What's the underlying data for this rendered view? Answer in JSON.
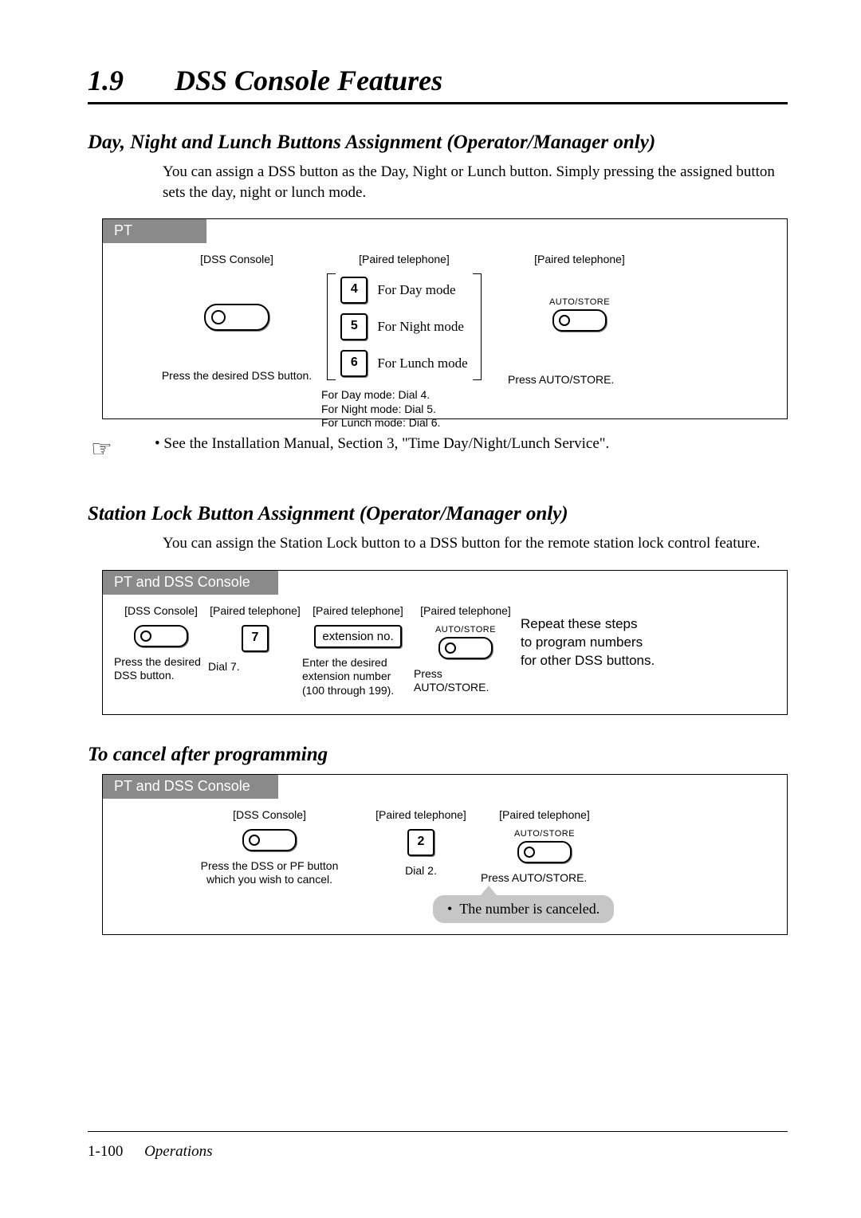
{
  "header": {
    "number": "1.9",
    "title": "DSS Console Features"
  },
  "sec1": {
    "heading": "Day, Night and Lunch Buttons Assignment (Operator/Manager only)",
    "intro": "You can assign a DSS button as the Day, Night or Lunch button. Simply pressing the assigned button sets the day, night or lunch mode.",
    "tab": "PT",
    "col1": {
      "label": "[DSS Console]",
      "caption": "Press the desired DSS button."
    },
    "col2": {
      "label": "[Paired telephone]",
      "rows": [
        {
          "key": "4",
          "text": "For Day mode"
        },
        {
          "key": "5",
          "text": "For Night mode"
        },
        {
          "key": "6",
          "text": "For Lunch mode"
        }
      ],
      "caption": "For Day mode: Dial 4.\nFor Night mode: Dial 5.\nFor Lunch mode: Dial 6."
    },
    "col3": {
      "label": "[Paired telephone]",
      "btn": "AUTO/STORE",
      "caption": "Press AUTO/STORE."
    },
    "note": "See the Installation Manual, Section 3, \"Time Day/Night/Lunch Service\"."
  },
  "sec2": {
    "heading": "Station Lock Button Assignment (Operator/Manager only)",
    "intro": "You can assign the Station Lock button to a DSS button for the remote station lock control feature.",
    "tab": "PT and DSS Console",
    "col1": {
      "label": "[DSS Console]",
      "caption": "Press the desired\nDSS button."
    },
    "col2": {
      "label": "[Paired telephone]",
      "key": "7",
      "caption": "Dial 7."
    },
    "col3": {
      "label": "[Paired telephone]",
      "box": "extension no.",
      "caption": "Enter the desired\nextension number\n(100 through 199)."
    },
    "col4": {
      "label": "[Paired telephone]",
      "btn": "AUTO/STORE",
      "caption": "Press AUTO/STORE."
    },
    "repeat": "Repeat these steps\nto program numbers\nfor other DSS buttons."
  },
  "sec3": {
    "heading": "To cancel after programming",
    "tab": "PT and DSS Console",
    "col1": {
      "label": "[DSS Console]",
      "caption": "Press the DSS or PF button\nwhich you wish to cancel."
    },
    "col2": {
      "label": "[Paired telephone]",
      "key": "2",
      "caption": "Dial 2."
    },
    "col3": {
      "label": "[Paired telephone]",
      "btn": "AUTO/STORE",
      "caption": "Press AUTO/STORE."
    },
    "callout": "The number is canceled."
  },
  "footer": {
    "page": "1-100",
    "section": "Operations"
  }
}
